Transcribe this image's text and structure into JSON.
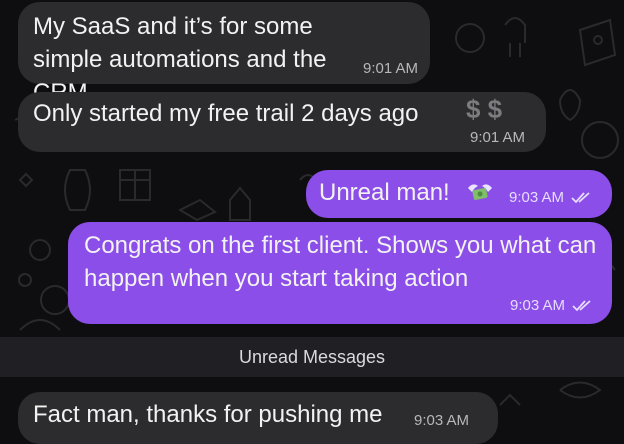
{
  "messages": [
    {
      "text": "My SaaS and it’s for some simple automations and the CRM",
      "time": "9:01 AM"
    },
    {
      "text": "Only started my free trail 2 days ago",
      "emoji": "$ $",
      "time": "9:01 AM"
    },
    {
      "text": "Unreal man!",
      "emoji": "money-with-wings",
      "time": "9:03 AM"
    },
    {
      "text": "Congrats on the first client. Shows you what can happen when you start taking action",
      "time": "9:03 AM"
    },
    {
      "text": "Fact man, thanks for pushing me",
      "time": "9:03 AM"
    }
  ],
  "divider": {
    "label": "Unread Messages"
  },
  "colors": {
    "background": "#0e0e10",
    "incoming": "#2c2c2e",
    "outgoing": "#8c4ee8",
    "divider": "#202024"
  },
  "icons": [
    "double-check-icon",
    "money-with-wings-icon",
    "dollar-sign-icon"
  ]
}
